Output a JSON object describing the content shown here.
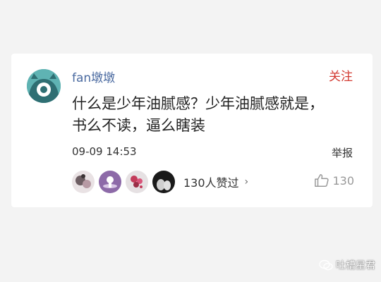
{
  "comment": {
    "username": "fan墩墩",
    "follow_label": "关注",
    "text_line1": "什么是少年油腻感？少年油腻感就是，",
    "text_line2": "书么不读，逼么瞎装",
    "timestamp": "09-09 14:53",
    "report_label": "举报",
    "liked_by_label": "130人赞过",
    "like_count": "130"
  },
  "watermark": {
    "label": "吐槽星君"
  },
  "colors": {
    "accent_red": "#d33a31",
    "username_blue": "#4a6aa0",
    "avatar_teal": "#5fb3b3"
  }
}
